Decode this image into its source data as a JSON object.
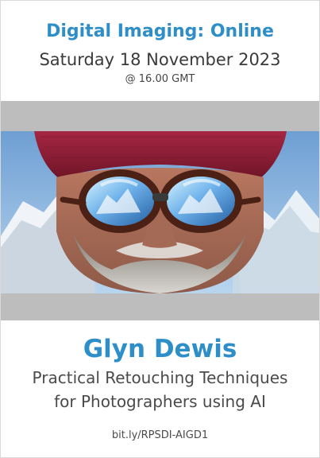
{
  "header": {
    "series_title": "Digital Imaging: Online",
    "event_date": "Saturday 18 November 2023",
    "event_time": "@ 16.00 GMT"
  },
  "photo": {
    "subject": "portrait-of-bearded-man-with-red-beanie-and-reflective-sunglasses"
  },
  "footer": {
    "speaker_name": "Glyn Dewis",
    "talk_title_line_1": "Practical Retouching Techniques",
    "talk_title_line_2": "for Photographers using AI",
    "short_link": "bit.ly/RPSDI-AIGD1"
  },
  "colors": {
    "accent": "#2e8ec8",
    "frame_gray": "#bdbdbd",
    "text_dark": "#3a3a3a",
    "beanie": "#8f1f35",
    "sky": "#8cb6e0"
  }
}
